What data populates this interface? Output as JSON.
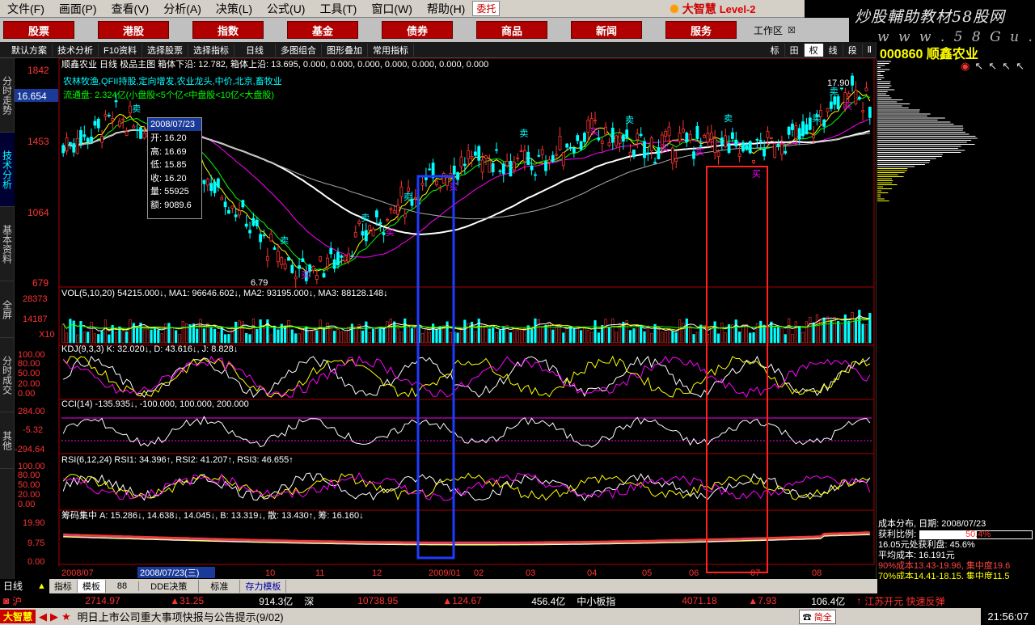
{
  "menu": [
    "文件(F)",
    "画面(P)",
    "查看(V)",
    "分析(A)",
    "决策(L)",
    "公式(U)",
    "工具(T)",
    "窗口(W)",
    "帮助(H)",
    "委托"
  ],
  "brand": {
    "name": "大智慧",
    "level": "Level-2"
  },
  "watermark": {
    "line1": "炒股輔助教材58股网",
    "line2": "w w w . 5 8 G u . c o m"
  },
  "nav": [
    "股票",
    "港股",
    "指数",
    "基金",
    "债券",
    "商品",
    "新闻",
    "服务"
  ],
  "workspace": "工作区",
  "toolbar": [
    "默认方案",
    "技术分析",
    "F10资料",
    "选择股票",
    "选择指标",
    "日线",
    "多图组合",
    "图形叠加",
    "常用指标"
  ],
  "toolbar_right": [
    "标",
    "田",
    "权",
    "线",
    "段",
    "Ⅱ"
  ],
  "sidetabs": [
    "分时走势",
    "技术分析",
    "基本资料",
    "全屏",
    "分时成交",
    "其他"
  ],
  "stock": {
    "code": "000860",
    "name": "顺鑫农业"
  },
  "price_panel": {
    "header": "顺鑫农业 日线  极品主图 箱体下沿: 12.782, 箱体上沿: 13.695, 0.000, 0.000, 0.000, 0.000, 0.000, 0.000, 0.000",
    "tags": "农林牧渔,QFII持股,定向增发,农业龙头,中价,北京,畜牧业",
    "float": "流通盘: 2.324亿(小盘股<5个亿<中盘股<10亿<大盘股)",
    "axis": [
      "1842",
      "1453",
      "1064",
      "679"
    ],
    "price_box": "16.654",
    "hi_label": "17.90",
    "lo_label": "6.79"
  },
  "tooltip": {
    "date": "2008/07/23",
    "rows": [
      "开: 16.20",
      "高: 16.69",
      "低: 15.85",
      "收: 16.20",
      "量: 55925",
      "额: 9089.6"
    ]
  },
  "vol_panel": {
    "header": "VOL(5,10,20) 54215.000↓, MA1: 96646.602↓, MA2: 93195.000↓, MA3: 88128.148↓",
    "axis": [
      "28373",
      "14187",
      "X10"
    ]
  },
  "kdj_panel": {
    "header": "KDJ(9,3,3) K: 32.020↓, D: 43.616↓, J: 8.828↓",
    "axis": [
      "100.00",
      "80.00",
      "50.00",
      "20.00",
      "0.00"
    ]
  },
  "cci_panel": {
    "header": "CCI(14) -135.935↓, -100.000, 100.000, 200.000",
    "axis": [
      "284.00",
      "-5.32",
      "-294.64"
    ]
  },
  "rsi_panel": {
    "header": "RSI(6,12,24) RSI1: 34.396↑, RSI2: 41.207↑, RSI3: 46.655↑",
    "axis": [
      "100.00",
      "80.00",
      "50.00",
      "20.00",
      "0.00"
    ]
  },
  "chip_panel": {
    "header": "筹码集中 A: 15.286↓, 14.638↓, 14.045↓, B: 13.319↓, 散: 13.430↑, 筹: 16.160↓",
    "axis": [
      "19.90",
      "9.75",
      "0.00"
    ]
  },
  "x_axis": {
    "labels": [
      "2008/07",
      "2008/07/23(三)",
      "10",
      "11",
      "12",
      "2009/01",
      "02",
      "03",
      "04",
      "05",
      "06",
      "07",
      "08"
    ]
  },
  "rp_info": {
    "title": "成本分布, 日期: 2008/07/23",
    "ratio_label": "获利比例:",
    "ratio": "50.4%",
    "line1": "16.05元处获利盘: 45.6%",
    "line2": "平均成本: 16.191元",
    "line3": "90%成本13.43-19.96, 集中度19.6",
    "line4": "70%成本14.41-18.15, 集中度11.5"
  },
  "bottom_tabs": [
    "指标",
    "模板",
    "88",
    "DDE决策",
    "标准",
    "存力模板"
  ],
  "day_label": "日线",
  "market": {
    "sh": "沪",
    "sh_idx": "2714.97",
    "sh_chg": "▲31.25",
    "sh_amt": "914.3亿",
    "sz": "深",
    "sz_idx": "10738.95",
    "sz_chg": "▲124.67",
    "sz_amt": "456.4亿",
    "sme": "中小板指",
    "sme_idx": "4071.18",
    "sme_chg": "▲7.93",
    "sme_amt": "106.4亿",
    "news": "江苏开元 快速反弹"
  },
  "ticker": {
    "text": "明日上市公司重大事项快报与公告提示(9/02)",
    "time": "21:56:07",
    "sms": "简全"
  },
  "colors": {
    "up": "#ff3333",
    "down": "#00ffff",
    "ma_white": "#ffffff",
    "ma_yellow": "#ffff00",
    "ma_green": "#00ff00",
    "ma_magenta": "#ff00ff",
    "blue_box": "#1e3cff",
    "red_box": "#ff2020"
  },
  "chart_data": [
    {
      "type": "candlestick",
      "title": "顺鑫农业 日线",
      "y_range": [
        6.79,
        18.42
      ],
      "high_label": 17.9,
      "low_label": 6.79,
      "buy_sell_markers": [
        "卖",
        "买",
        "卖",
        "买",
        "卖",
        "买",
        "卖",
        "买",
        "卖",
        "买",
        "卖",
        "买"
      ]
    },
    {
      "type": "bar",
      "title": "VOL(5,10,20)",
      "ylim": [
        0,
        28373
      ],
      "series": [
        {
          "name": "MA1",
          "last": 96646.602
        },
        {
          "name": "MA2",
          "last": 93195.0
        },
        {
          "name": "MA3",
          "last": 88128.148
        }
      ],
      "last": 54215.0
    },
    {
      "type": "line",
      "title": "KDJ(9,3,3)",
      "ylim": [
        0,
        100
      ],
      "series": [
        {
          "name": "K",
          "last": 32.02
        },
        {
          "name": "D",
          "last": 43.616
        },
        {
          "name": "J",
          "last": 8.828
        }
      ]
    },
    {
      "type": "line",
      "title": "CCI(14)",
      "ylim": [
        -294.64,
        284.0
      ],
      "series": [
        {
          "name": "CCI",
          "last": -135.935
        }
      ],
      "ref_lines": [
        -100,
        100,
        200
      ]
    },
    {
      "type": "line",
      "title": "RSI(6,12,24)",
      "ylim": [
        0,
        100
      ],
      "series": [
        {
          "name": "RSI1",
          "last": 34.396
        },
        {
          "name": "RSI2",
          "last": 41.207
        },
        {
          "name": "RSI3",
          "last": 46.655
        }
      ]
    },
    {
      "type": "line",
      "title": "筹码集中",
      "ylim": [
        0,
        19.9
      ],
      "series": [
        {
          "name": "A",
          "values": [
            15.286,
            14.638,
            14.045
          ]
        },
        {
          "name": "B",
          "last": 13.319
        },
        {
          "name": "散",
          "last": 13.43
        },
        {
          "name": "筹",
          "last": 16.16
        }
      ]
    }
  ]
}
